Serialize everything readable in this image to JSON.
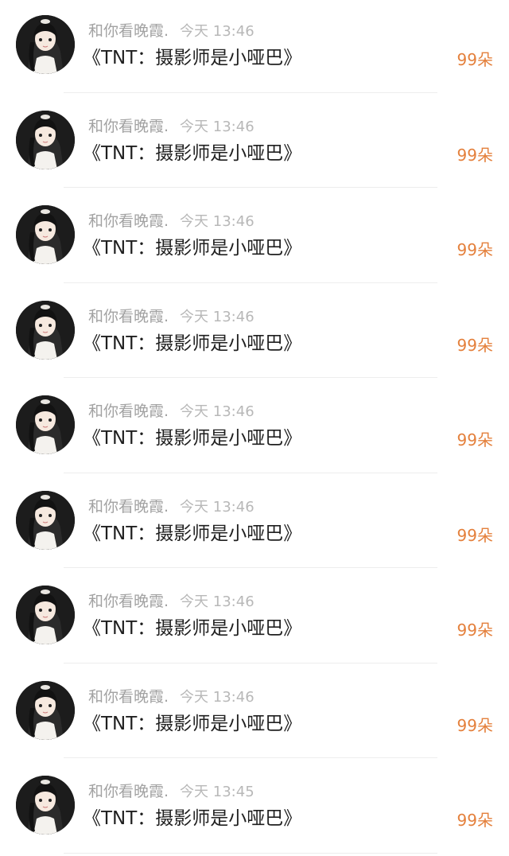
{
  "colors": {
    "name": "#a2a2a2",
    "time": "#b8b8b8",
    "title": "#1f1f1f",
    "count": "#e4803c",
    "divider": "#ededed"
  },
  "list": {
    "items": [
      {
        "avatar_icon": "user-avatar-icon",
        "name": "和你看晚霞.",
        "time": "今天 13:46",
        "title": "《TNT：摄影师是小哑巴》",
        "count": "99朵"
      },
      {
        "avatar_icon": "user-avatar-icon",
        "name": "和你看晚霞.",
        "time": "今天 13:46",
        "title": "《TNT：摄影师是小哑巴》",
        "count": "99朵"
      },
      {
        "avatar_icon": "user-avatar-icon",
        "name": "和你看晚霞.",
        "time": "今天 13:46",
        "title": "《TNT：摄影师是小哑巴》",
        "count": "99朵"
      },
      {
        "avatar_icon": "user-avatar-icon",
        "name": "和你看晚霞.",
        "time": "今天 13:46",
        "title": "《TNT：摄影师是小哑巴》",
        "count": "99朵"
      },
      {
        "avatar_icon": "user-avatar-icon",
        "name": "和你看晚霞.",
        "time": "今天 13:46",
        "title": "《TNT：摄影师是小哑巴》",
        "count": "99朵"
      },
      {
        "avatar_icon": "user-avatar-icon",
        "name": "和你看晚霞.",
        "time": "今天 13:46",
        "title": "《TNT：摄影师是小哑巴》",
        "count": "99朵"
      },
      {
        "avatar_icon": "user-avatar-icon",
        "name": "和你看晚霞.",
        "time": "今天 13:46",
        "title": "《TNT：摄影师是小哑巴》",
        "count": "99朵"
      },
      {
        "avatar_icon": "user-avatar-icon",
        "name": "和你看晚霞.",
        "time": "今天 13:46",
        "title": "《TNT：摄影师是小哑巴》",
        "count": "99朵"
      },
      {
        "avatar_icon": "user-avatar-icon",
        "name": "和你看晚霞.",
        "time": "今天 13:45",
        "title": "《TNT：摄影师是小哑巴》",
        "count": "99朵"
      }
    ]
  }
}
